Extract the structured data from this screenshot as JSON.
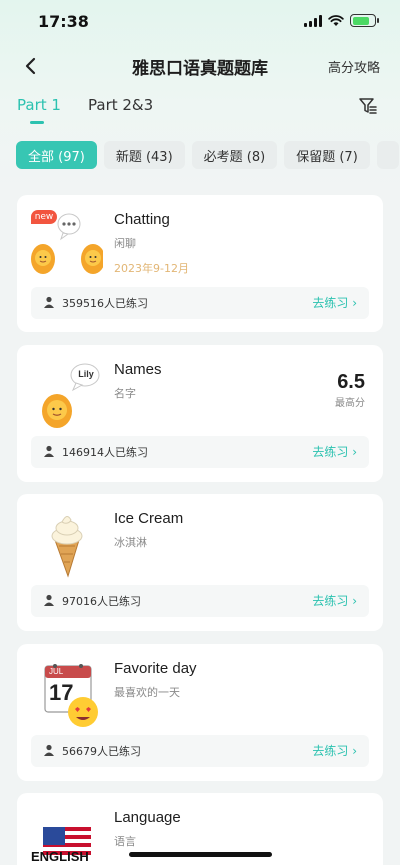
{
  "status": {
    "time": "17:38"
  },
  "nav": {
    "title": "雅思口语真题题库",
    "right_link": "高分攻略"
  },
  "tabs": [
    "Part 1",
    "Part 2&3"
  ],
  "chips": [
    "全部 (97)",
    "新题 (43)",
    "必考题 (8)",
    "保留题 (7)"
  ],
  "cards": [
    {
      "title": "Chatting",
      "subtitle": "闲聊",
      "date": "2023年9-12月",
      "badge": "new",
      "count": "359516人已练习",
      "action": "去练习 ›"
    },
    {
      "title": "Names",
      "subtitle": "名字",
      "bubble": "Lily",
      "score": "6.5",
      "score_label": "最高分",
      "count": "146914人已练习",
      "action": "去练习 ›"
    },
    {
      "title": "Ice Cream",
      "subtitle": "冰淇淋",
      "count": "97016人已练习",
      "action": "去练习 ›"
    },
    {
      "title": "Favorite day",
      "subtitle": "最喜欢的一天",
      "calendar_month": "JUL",
      "calendar_day": "17",
      "count": "56679人已练习",
      "action": "去练习 ›"
    },
    {
      "title": "Language",
      "subtitle": "语言",
      "thumb_text": "ENGLISH"
    }
  ],
  "colors": {
    "accent": "#2cc2b0",
    "date": "#e2b675",
    "background": "#f1f4f4"
  }
}
